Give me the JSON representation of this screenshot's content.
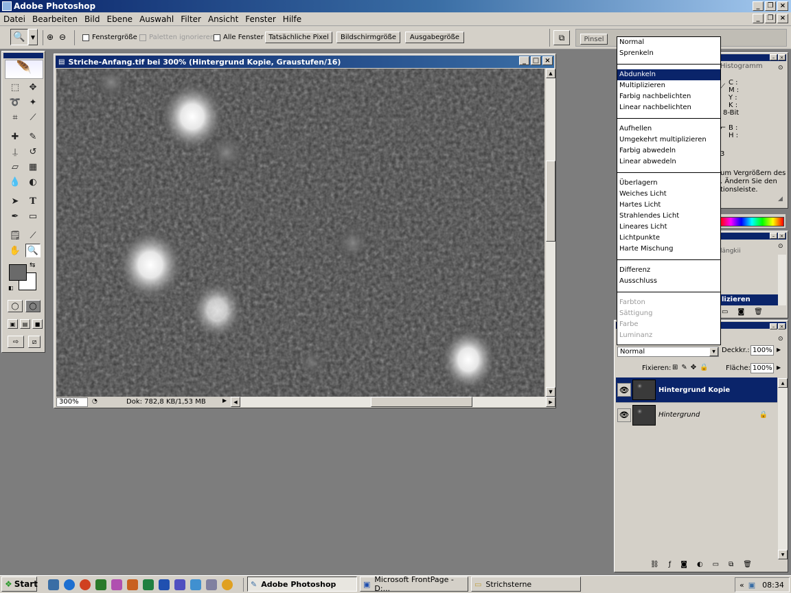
{
  "app": {
    "title": "Adobe Photoshop"
  },
  "menu": [
    "Datei",
    "Bearbeiten",
    "Bild",
    "Ebene",
    "Auswahl",
    "Filter",
    "Ansicht",
    "Fenster",
    "Hilfe"
  ],
  "options": {
    "fenstergroesse": "Fenstergröße",
    "paletten_ignorieren": "Paletten ignorieren",
    "alle_fenster": "Alle Fenster",
    "tatsaechliche_pixel": "Tatsächliche Pixel",
    "bildschirmgroesse": "Bildschirmgröße",
    "ausgabegroesse": "Ausgabegröße",
    "pinsel_tab": "Pinsel"
  },
  "document": {
    "title": "Striche-Anfang.tif bei 300% (Hintergrund Kopie, Graustufen/16)",
    "zoom": "300%",
    "doc_size": "Dok: 782,8 KB/1,53 MB"
  },
  "info_panel": {
    "tab": "Histogramm",
    "c": "C :",
    "m": "M :",
    "y": "Y :",
    "k": "K :",
    "bits": "8-Bit",
    "b": "B :",
    "h": "H :",
    "digit": "3",
    "hint_lines": [
      "um Vergrößern des",
      ". Ändern Sie den",
      "tionsleiste."
    ]
  },
  "actions_panel": {
    "label": "lizieren",
    "partial": "längkii"
  },
  "blend_modes": {
    "selected": "Abdunkeln",
    "groups": [
      [
        "Normal",
        "Sprenkeln"
      ],
      [
        "Abdunkeln",
        "Multiplizieren",
        "Farbig nachbelichten",
        "Linear nachbelichten"
      ],
      [
        "Aufhellen",
        "Umgekehrt multiplizieren",
        "Farbig abwedeln",
        "Linear abwedeln"
      ],
      [
        "Überlagern",
        "Weiches Licht",
        "Hartes Licht",
        "Strahlendes Licht",
        "Lineares Licht",
        "Lichtpunkte",
        "Harte Mischung"
      ],
      [
        "Differenz",
        "Ausschluss"
      ]
    ],
    "disabled": [
      "Farbton",
      "Sättigung",
      "Farbe",
      "Luminanz"
    ]
  },
  "layers": {
    "mode": "Normal",
    "opacity_label": "Deckkr.:",
    "opacity": "100%",
    "lock_label": "Fixieren:",
    "fill_label": "Fläche:",
    "fill": "100%",
    "items": [
      {
        "name": "Hintergrund Kopie",
        "selected": true
      },
      {
        "name": "Hintergrund",
        "selected": false
      }
    ]
  },
  "taskbar": {
    "start": "Start",
    "tasks": [
      "Adobe Photoshop",
      "Microsoft FrontPage - D:...",
      "Strichsterne"
    ],
    "clock": "08:34"
  },
  "colors": {
    "titlebar": "#0a246a",
    "selection": "#0a246a",
    "chrome": "#d4d0c8"
  }
}
